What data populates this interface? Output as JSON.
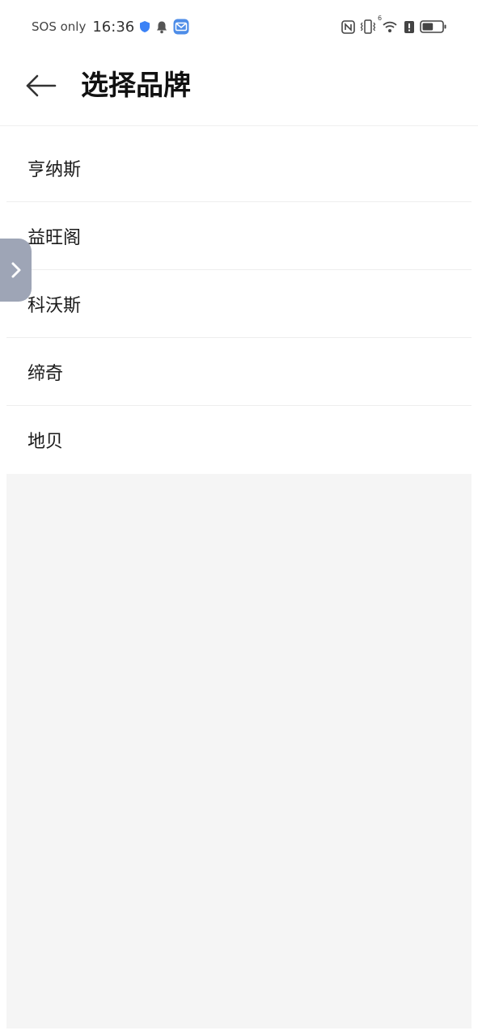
{
  "status_bar": {
    "carrier": "SOS only",
    "time": "16:36",
    "left_icons": [
      "shield-icon",
      "bell-icon",
      "mail-app-icon"
    ],
    "right_icons": [
      "nfc-icon",
      "vibrate-icon",
      "wifi-icon",
      "alert-icon",
      "battery-icon"
    ],
    "wifi_label": "6",
    "battery_level": 0.55
  },
  "header": {
    "back_icon": "arrow-left-icon",
    "title": "选择品牌"
  },
  "brands": [
    {
      "label": "亨纳斯"
    },
    {
      "label": "益旺阁"
    },
    {
      "label": "科沃斯"
    },
    {
      "label": "缔奇"
    },
    {
      "label": "地贝"
    }
  ],
  "side_handle": {
    "icon": "chevron-right-icon"
  },
  "colors": {
    "background": "#ffffff",
    "empty_area": "#f5f5f5",
    "side_handle": "#9ea5b6",
    "shield_blue": "#3b82f6"
  }
}
